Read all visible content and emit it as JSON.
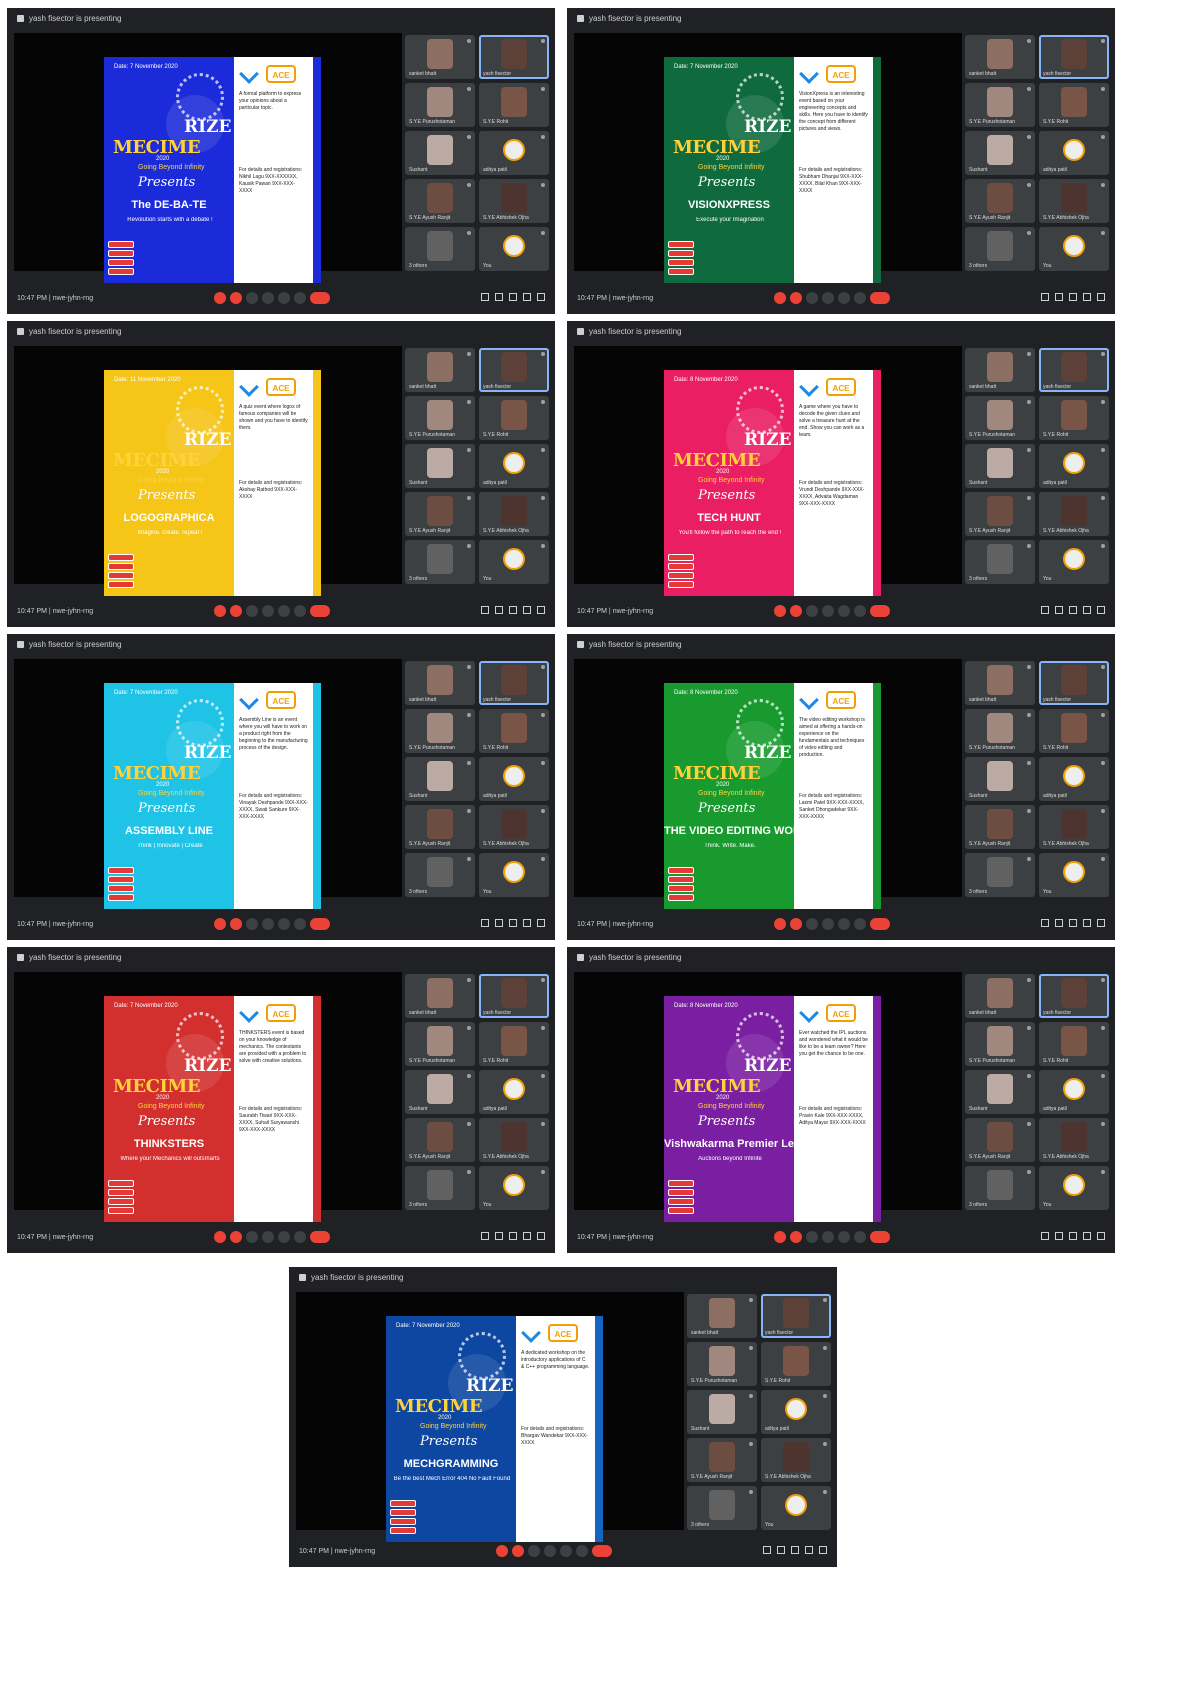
{
  "window": {
    "title": "yash fisector is presenting",
    "time": "10:47 PM",
    "meeting": "nwe-jyhn-rng"
  },
  "colors": {
    "ctrl_red": "#ea4335",
    "panel_bg": "#202124",
    "tile_bg": "#3c4043",
    "accent": "#8ab4f8"
  },
  "poster_common": {
    "rize": "RIZE",
    "mecime": "MECIME",
    "year": "2020",
    "tagline": "Going Beyond Infinity",
    "presents": "Presents",
    "logo_text": "ACE"
  },
  "participants": [
    {
      "name": "sanket bhatt",
      "avatar": "#8d6e63",
      "selected": false,
      "emblem": false
    },
    {
      "name": "yash fisector",
      "avatar": "#5d4037",
      "selected": true,
      "emblem": false
    },
    {
      "name": "S.Y.E Purushotaman",
      "avatar": "#a1887f",
      "selected": false,
      "emblem": false
    },
    {
      "name": "S.Y.E Rohit",
      "avatar": "#795548",
      "selected": false,
      "emblem": false
    },
    {
      "name": "Sushant",
      "avatar": "#bcaaa4",
      "selected": false,
      "emblem": false
    },
    {
      "name": "aditya patil",
      "avatar": "#9e9e9e",
      "selected": false,
      "emblem": true
    },
    {
      "name": "S.Y.E Ayush Ranjit",
      "avatar": "#6d4c41",
      "selected": false,
      "emblem": false
    },
    {
      "name": "S.Y.E Abhishek Ojha",
      "avatar": "#4e342e",
      "selected": false,
      "emblem": false
    },
    {
      "name": "3 others",
      "avatar": "#616161",
      "selected": false,
      "emblem": false
    },
    {
      "name": "You",
      "avatar": "#757575",
      "selected": false,
      "emblem": true
    }
  ],
  "screens": [
    {
      "date": "Date: 7 November 2020",
      "event": "The DE-BA-TE",
      "subtitle": "Revolution starts with a debate !",
      "bg": "#1c2bd9",
      "strip": "#1c2bd9",
      "description": "A formal platform to express your opinions about a particular topic.",
      "contact": "For details and registrations: Nikhil Lagu 9XX-XXXXXX, Kausik Pawan 9XX-XXX-XXXX"
    },
    {
      "date": "Date: 7 November 2020",
      "event": "VISIONXPRESS",
      "subtitle": "Execute your Imagination",
      "bg": "#0f6b3e",
      "strip": "#0f6b3e",
      "description": "VisionXpress is an interesting event based on your engineering concepts and skills. Here you have to identify the concept from different pictures and views.",
      "contact": "For details and registrations: Shubham Dhanjal 9XX-XXX-XXXX, Bilal Khan 9XX-XXX-XXXX"
    },
    {
      "date": "Date: 11 November 2020",
      "event": "LOGOGRAPHICA",
      "subtitle": "Imagine. create. repeat !",
      "bg": "#f5c518",
      "strip": "#f5c518",
      "description": "A quiz event where logos of famous companies will be shown and you have to identify them.",
      "contact": "For details and registrations: Akshay Rathod 9XX-XXX-XXXX"
    },
    {
      "date": "Date: 8 November 2020",
      "event": "TECH HUNT",
      "subtitle": "You'll follow the path to reach the end !",
      "bg": "#e91e63",
      "strip": "#e91e63",
      "description": "A game where you have to decode the given clues and solve a treasure hunt at the end. Show you can work as a team.",
      "contact": "For details and registrations: Vrundi Deshpande 9XX-XXX-XXXX, Advaita Wagdaman 9XX-XXX-XXXX"
    },
    {
      "date": "Date: 7 November 2020",
      "event": "ASSEMBLY LINE",
      "subtitle": "Think | Innovate | Create",
      "bg": "#1ec3e6",
      "strip": "#1ec3e6",
      "description": "Assembly Line is an event where you will have to work on a product right from the beginning to the manufacturing process of the design.",
      "contact": "For details and registrations: Vinayak Deshpande 9XX-XXX-XXXX, Swati Sankure 9XX-XXX-XXXX"
    },
    {
      "date": "Date: 8 November 2020",
      "event": "THE VIDEO EDITING WORKSHOP",
      "subtitle": "Think. Write. Make.",
      "bg": "#189a2e",
      "strip": "#189a2e",
      "description": "The video editing workshop is aimed at offering a hands-on experience on the fundamentals and techniques of video editing and production.",
      "contact": "For details and registrations: Laxmi Patel 9XX-XXX-XXXX, Sanket Dhongadekar 9XX-XXX-XXXX"
    },
    {
      "date": "Date: 7 November 2020",
      "event": "THINKSTERS",
      "subtitle": "Where your Mechanics will outsmarts",
      "bg": "#d32f2f",
      "strip": "#d32f2f",
      "description": "THINKSTERS event is based on your knowledge of mechanics. The contestants are provided with a problem to solve with creative solutions.",
      "contact": "For details and registrations: Saurabh Tiwari 9XX-XXX-XXXX, Suhail Suryawanshi 9XX-XXX-XXXX"
    },
    {
      "date": "Date: 8 November 2020",
      "event": "Vishwakarma Premier League (VPL)",
      "subtitle": "Auctions beyond Infinite",
      "bg": "#7b1fa2",
      "strip": "#7b1fa2",
      "description": "Ever watched the IPL auctions and wondered what it would be like to be a team owner? Here you get the chance to be one.",
      "contact": "For details and registrations: Pravin Kale 9XX-XXX-XXXX, Aditya Mayur 9XX-XXX-XXXX"
    },
    {
      "date": "Date: 7 November 2020",
      "event": "MECHGRAMMING",
      "subtitle": "Be the best Mech Error 404 No Fault Found",
      "bg": "#0d47a1",
      "strip": "#1565c0",
      "description": "A dedicated workshop on the introductory applications of C & C++ programming language.",
      "contact": "For details and registrations: Bhargav Wandekar 9XX-XXX-XXXX"
    }
  ]
}
